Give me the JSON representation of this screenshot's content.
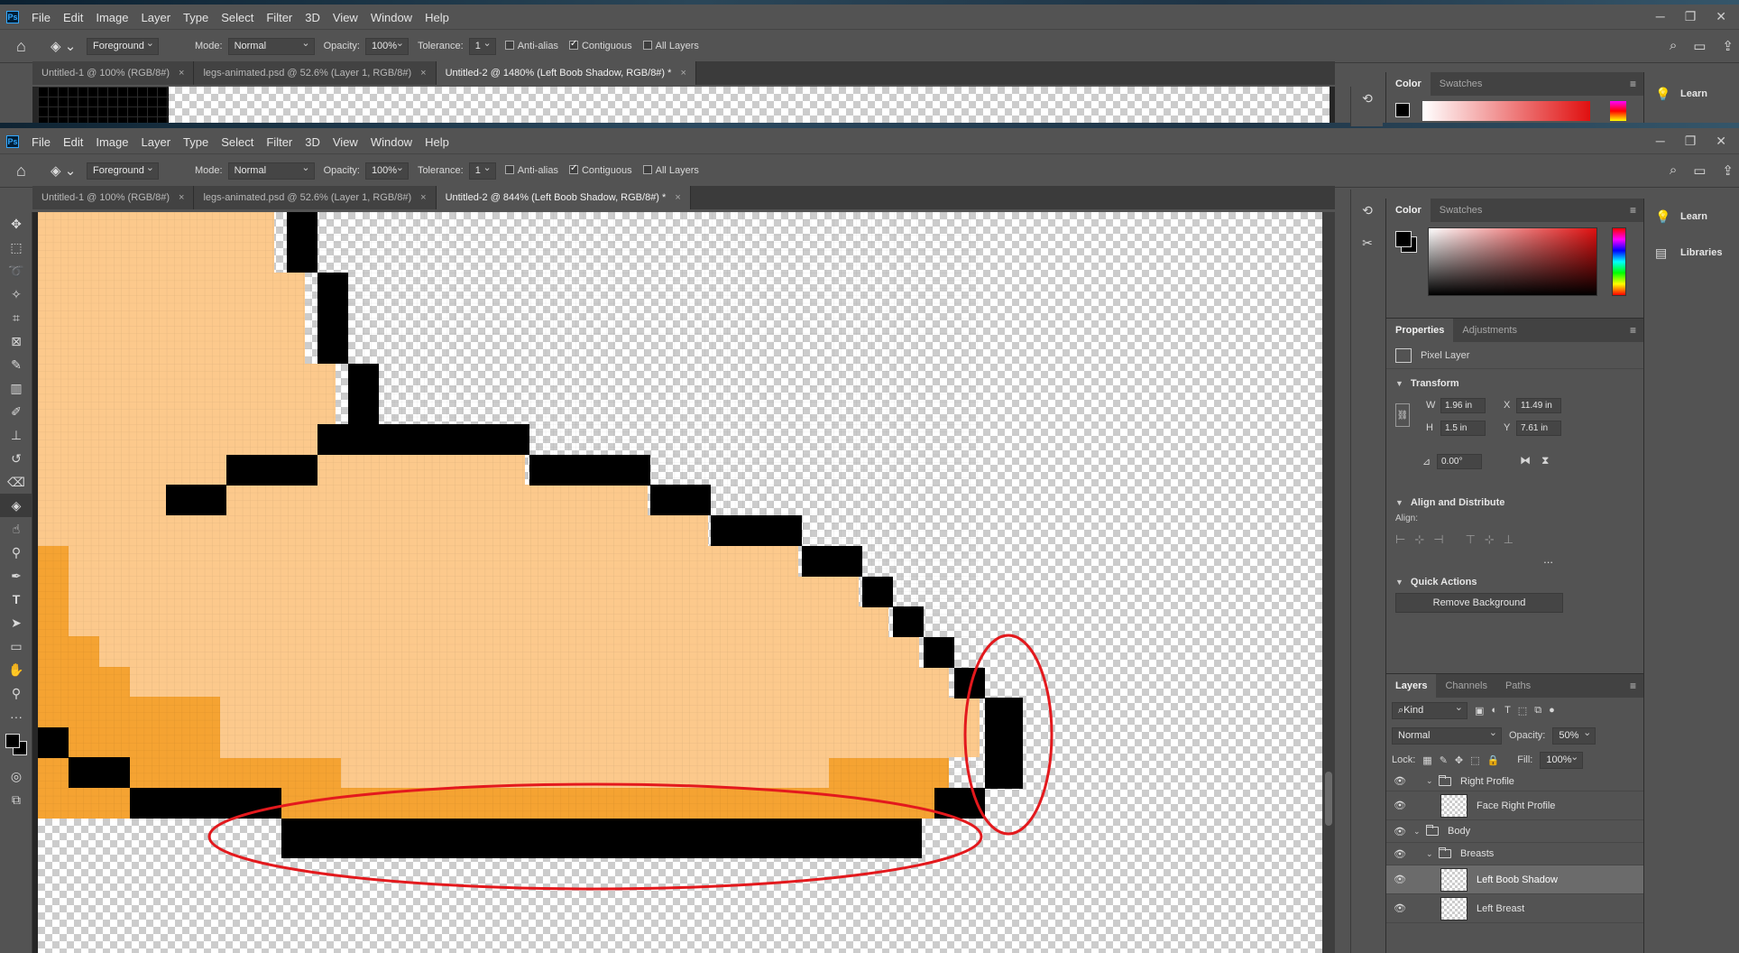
{
  "app": {
    "logo": "Ps",
    "menu": [
      "File",
      "Edit",
      "Image",
      "Layer",
      "Type",
      "Select",
      "Filter",
      "3D",
      "View",
      "Window",
      "Help"
    ]
  },
  "options": {
    "fill_source": "Foreground",
    "mode_label": "Mode:",
    "mode_value": "Normal",
    "opacity_label": "Opacity:",
    "opacity_value": "100%",
    "tolerance_label": "Tolerance:",
    "tolerance_value": "1",
    "anti_alias": "Anti-alias",
    "contiguous": "Contiguous",
    "all_layers": "All Layers"
  },
  "tabs_top": [
    {
      "label": "Untitled-1 @ 100% (RGB/8#)"
    },
    {
      "label": "legs-animated.psd @ 52.6% (Layer 1, RGB/8#)"
    },
    {
      "label": "Untitled-2 @ 1480% (Left Boob Shadow, RGB/8#) *"
    }
  ],
  "tabs_main": [
    {
      "label": "Untitled-1 @ 100% (RGB/8#)"
    },
    {
      "label": "legs-animated.psd @ 52.6% (Layer 1, RGB/8#)"
    },
    {
      "label": "Untitled-2 @ 844% (Left Boob Shadow, RGB/8#) *"
    }
  ],
  "right": {
    "color_tab": "Color",
    "swatches_tab": "Swatches",
    "learn": "Learn",
    "libraries": "Libraries",
    "properties_tab": "Properties",
    "adjustments_tab": "Adjustments",
    "pixel_layer": "Pixel Layer",
    "transform": "Transform",
    "w_label": "W",
    "w_value": "1.96 in",
    "h_label": "H",
    "h_value": "1.5 in",
    "x_label": "X",
    "x_value": "11.49 in",
    "y_label": "Y",
    "y_value": "7.61 in",
    "angle_value": "0.00°",
    "align_distribute": "Align and Distribute",
    "align_label": "Align:",
    "more": "...",
    "quick_actions": "Quick Actions",
    "remove_bg": "Remove Background",
    "layers_tab": "Layers",
    "channels_tab": "Channels",
    "paths_tab": "Paths",
    "kind": "Kind",
    "blend_mode": "Normal",
    "layer_opacity_label": "Opacity:",
    "layer_opacity_value": "50%",
    "lock_label": "Lock:",
    "fill_label": "Fill:",
    "fill_value": "100%"
  },
  "layers": [
    {
      "name": "Right Profile",
      "kind": "group"
    },
    {
      "name": "Face Right Profile",
      "kind": "layer"
    },
    {
      "name": "Body",
      "kind": "group"
    },
    {
      "name": "Breasts",
      "kind": "group"
    },
    {
      "name": "Left Boob Shadow",
      "kind": "layer"
    },
    {
      "name": "Left Breast",
      "kind": "layer"
    }
  ],
  "colors": {
    "skin": "#fcc98c",
    "shadow": "#f5a332",
    "outline": "#000000",
    "annotation": "#e3191d",
    "ui_bg": "#535353"
  }
}
